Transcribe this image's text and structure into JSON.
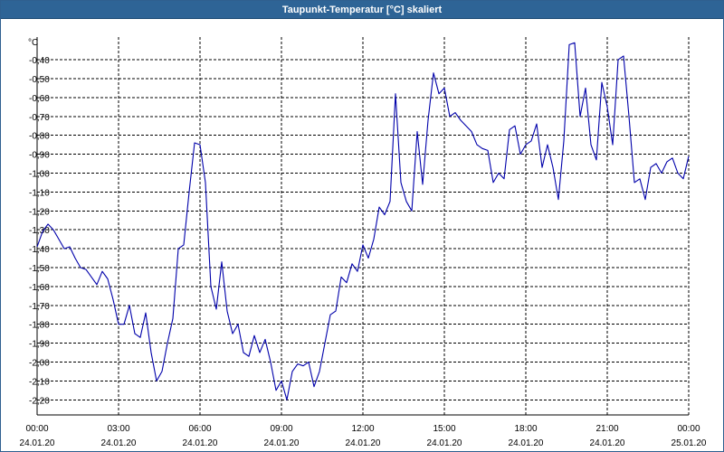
{
  "window": {
    "title": "Taupunkt-Temperatur [°C] skaliert"
  },
  "colors": {
    "titlebar": "#2e6496",
    "line": "#0000aa",
    "grid": "#000000"
  },
  "chart_data": {
    "type": "line",
    "title": "Taupunkt-Temperatur [°C] skaliert",
    "ylabel": "°C",
    "xlabel": "",
    "grid": true,
    "legend": "none",
    "ylim": [
      -2.28,
      -0.28
    ],
    "xlim": [
      "24.01.20 00:00",
      "25.01.20 00:00"
    ],
    "x_ticks": [
      {
        "time": "00:00",
        "date": "24.01.20"
      },
      {
        "time": "03:00",
        "date": "24.01.20"
      },
      {
        "time": "06:00",
        "date": "24.01.20"
      },
      {
        "time": "09:00",
        "date": "24.01.20"
      },
      {
        "time": "12:00",
        "date": "24.01.20"
      },
      {
        "time": "15:00",
        "date": "24.01.20"
      },
      {
        "time": "18:00",
        "date": "24.01.20"
      },
      {
        "time": "21:00",
        "date": "24.01.20"
      },
      {
        "time": "00:00",
        "date": "25.01.20"
      }
    ],
    "y_ticks": [
      "-0,40",
      "-0,50",
      "-0,60",
      "-0,70",
      "-0,80",
      "-0,90",
      "-1,00",
      "-1,10",
      "-1,20",
      "-1,30",
      "-1,40",
      "-1,50",
      "-1,60",
      "-1,70",
      "-1,80",
      "-1,90",
      "-2,00",
      "-2,10",
      "-2,20"
    ],
    "y_tick_values": [
      -0.4,
      -0.5,
      -0.6,
      -0.7,
      -0.8,
      -0.9,
      -1.0,
      -1.1,
      -1.2,
      -1.3,
      -1.4,
      -1.5,
      -1.6,
      -1.7,
      -1.8,
      -1.9,
      -2.0,
      -2.1,
      -2.2
    ],
    "series": [
      {
        "x": [
          "24.01.20 00:00",
          "24.01.20 00:12",
          "24.01.20 00:24",
          "24.01.20 00:36",
          "24.01.20 00:48",
          "24.01.20 01:00",
          "24.01.20 01:12",
          "24.01.20 01:24",
          "24.01.20 01:36",
          "24.01.20 01:48",
          "24.01.20 02:00",
          "24.01.20 02:12",
          "24.01.20 02:24",
          "24.01.20 02:36",
          "24.01.20 02:48",
          "24.01.20 03:00",
          "24.01.20 03:12",
          "24.01.20 03:24",
          "24.01.20 03:36",
          "24.01.20 03:48",
          "24.01.20 04:00",
          "24.01.20 04:12",
          "24.01.20 04:24",
          "24.01.20 04:36",
          "24.01.20 04:48",
          "24.01.20 05:00",
          "24.01.20 05:12",
          "24.01.20 05:24",
          "24.01.20 05:36",
          "24.01.20 05:48",
          "24.01.20 06:00",
          "24.01.20 06:12",
          "24.01.20 06:24",
          "24.01.20 06:36",
          "24.01.20 06:48",
          "24.01.20 07:00",
          "24.01.20 07:12",
          "24.01.20 07:24",
          "24.01.20 07:36",
          "24.01.20 07:48",
          "24.01.20 08:00",
          "24.01.20 08:12",
          "24.01.20 08:24",
          "24.01.20 08:36",
          "24.01.20 08:48",
          "24.01.20 09:00",
          "24.01.20 09:12",
          "24.01.20 09:24",
          "24.01.20 09:36",
          "24.01.20 09:48",
          "24.01.20 10:00",
          "24.01.20 10:12",
          "24.01.20 10:24",
          "24.01.20 10:36",
          "24.01.20 10:48",
          "24.01.20 11:00",
          "24.01.20 11:12",
          "24.01.20 11:24",
          "24.01.20 11:36",
          "24.01.20 11:48",
          "24.01.20 12:00",
          "24.01.20 12:12",
          "24.01.20 12:24",
          "24.01.20 12:36",
          "24.01.20 12:48",
          "24.01.20 13:00",
          "24.01.20 13:12",
          "24.01.20 13:24",
          "24.01.20 13:36",
          "24.01.20 13:48",
          "24.01.20 14:00",
          "24.01.20 14:12",
          "24.01.20 14:24",
          "24.01.20 14:36",
          "24.01.20 14:48",
          "24.01.20 15:00",
          "24.01.20 15:12",
          "24.01.20 15:24",
          "24.01.20 15:36",
          "24.01.20 15:48",
          "24.01.20 16:00",
          "24.01.20 16:12",
          "24.01.20 16:24",
          "24.01.20 16:36",
          "24.01.20 16:48",
          "24.01.20 17:00",
          "24.01.20 17:12",
          "24.01.20 17:24",
          "24.01.20 17:36",
          "24.01.20 17:48",
          "24.01.20 18:00",
          "24.01.20 18:12",
          "24.01.20 18:24",
          "24.01.20 18:36",
          "24.01.20 18:48",
          "24.01.20 19:00",
          "24.01.20 19:12",
          "24.01.20 19:24",
          "24.01.20 19:36",
          "24.01.20 19:48",
          "24.01.20 20:00",
          "24.01.20 20:12",
          "24.01.20 20:24",
          "24.01.20 20:36",
          "24.01.20 20:48",
          "24.01.20 21:00",
          "24.01.20 21:12",
          "24.01.20 21:24",
          "24.01.20 21:36",
          "24.01.20 21:48",
          "24.01.20 22:00",
          "24.01.20 22:12",
          "24.01.20 22:24",
          "24.01.20 22:36",
          "24.01.20 22:48",
          "24.01.20 23:00",
          "24.01.20 23:12",
          "24.01.20 23:24",
          "24.01.20 23:36",
          "24.01.20 23:48",
          "25.01.20 00:00"
        ],
        "values": [
          -1.39,
          -1.31,
          -1.27,
          -1.3,
          -1.35,
          -1.4,
          -1.39,
          -1.45,
          -1.5,
          -1.51,
          -1.55,
          -1.59,
          -1.52,
          -1.56,
          -1.67,
          -1.8,
          -1.8,
          -1.7,
          -1.85,
          -1.87,
          -1.74,
          -1.95,
          -2.1,
          -2.05,
          -1.9,
          -1.77,
          -1.4,
          -1.38,
          -1.1,
          -0.84,
          -0.85,
          -1.05,
          -1.6,
          -1.72,
          -1.47,
          -1.73,
          -1.85,
          -1.8,
          -1.95,
          -1.97,
          -1.86,
          -1.95,
          -1.88,
          -2.0,
          -2.15,
          -2.1,
          -2.2,
          -2.05,
          -2.01,
          -2.02,
          -2.0,
          -2.13,
          -2.05,
          -1.9,
          -1.75,
          -1.73,
          -1.55,
          -1.58,
          -1.48,
          -1.52,
          -1.38,
          -1.45,
          -1.35,
          -1.18,
          -1.22,
          -1.15,
          -0.58,
          -1.05,
          -1.15,
          -1.2,
          -0.78,
          -1.06,
          -0.72,
          -0.47,
          -0.58,
          -0.55,
          -0.7,
          -0.68,
          -0.72,
          -0.75,
          -0.78,
          -0.85,
          -0.87,
          -0.88,
          -1.05,
          -1.0,
          -1.03,
          -0.77,
          -0.75,
          -0.9,
          -0.85,
          -0.83,
          -0.74,
          -0.97,
          -0.85,
          -0.97,
          -1.14,
          -0.83,
          -0.32,
          -0.31,
          -0.7,
          -0.55,
          -0.85,
          -0.93,
          -0.52,
          -0.65,
          -0.85,
          -0.4,
          -0.38,
          -0.7,
          -1.05,
          -1.03,
          -1.14,
          -0.97,
          -0.95,
          -1.0,
          -0.94,
          -0.92,
          -1.0,
          -1.03,
          -0.91
        ]
      }
    ]
  }
}
